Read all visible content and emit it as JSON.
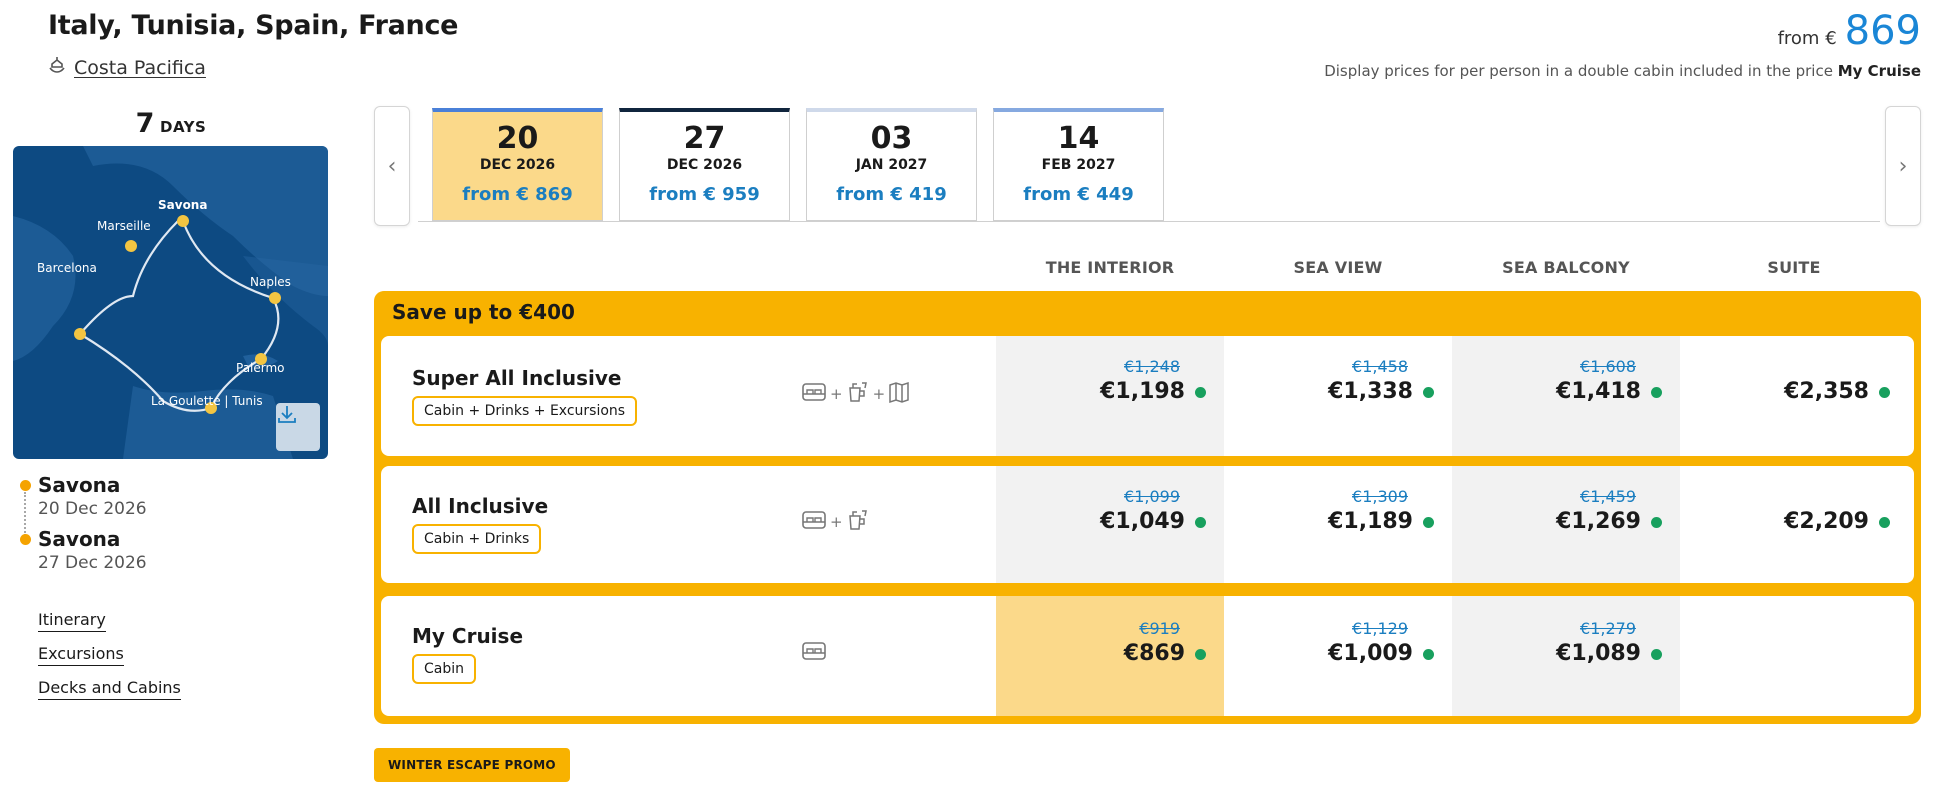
{
  "header": {
    "title": "Italy, Tunisia, Spain, France",
    "ship": "Costa Pacifica",
    "from_label": "from €",
    "from_price": "869",
    "disclaimer": "Display prices for per person in a double cabin included in the price",
    "disclaimer_bold": "My Cruise"
  },
  "duration": {
    "number": "7",
    "label": "DAYS"
  },
  "map": {
    "ports": [
      "Savona",
      "Marseille",
      "Barcelona",
      "Naples",
      "Palermo",
      "La Goulette | Tunis"
    ]
  },
  "stops": [
    {
      "name": "Savona",
      "date": "20 Dec 2026"
    },
    {
      "name": "Savona",
      "date": "27 Dec 2026"
    }
  ],
  "links": [
    "Itinerary",
    "Excursions",
    "Decks and Cabins"
  ],
  "dates": [
    {
      "day": "20",
      "month": "DEC 2026",
      "price": "from € 869"
    },
    {
      "day": "27",
      "month": "DEC 2026",
      "price": "from € 959"
    },
    {
      "day": "03",
      "month": "JAN 2027",
      "price": "from € 419"
    },
    {
      "day": "14",
      "month": "FEB 2027",
      "price": "from € 449"
    }
  ],
  "columns": [
    "THE INTERIOR",
    "SEA VIEW",
    "SEA BALCONY",
    "SUITE"
  ],
  "promo_title": "Save up to €400",
  "rates": [
    {
      "name": "Super All Inclusive",
      "tag": "Cabin + Drinks + Excursions",
      "icons": [
        "bed-icon",
        "drink-icon",
        "map-icon"
      ],
      "plus": "+",
      "prices": [
        {
          "old": "€1,248",
          "new": "€1,198"
        },
        {
          "old": "€1,458",
          "new": "€1,338"
        },
        {
          "old": "€1,608",
          "new": "€1,418"
        },
        {
          "old": "",
          "new": "€2,358"
        }
      ]
    },
    {
      "name": "All Inclusive",
      "tag": "Cabin + Drinks",
      "icons": [
        "bed-icon",
        "drink-icon"
      ],
      "plus": "+",
      "prices": [
        {
          "old": "€1,099",
          "new": "€1,049"
        },
        {
          "old": "€1,309",
          "new": "€1,189"
        },
        {
          "old": "€1,459",
          "new": "€1,269"
        },
        {
          "old": "",
          "new": "€2,209"
        }
      ]
    },
    {
      "name": "My Cruise",
      "tag": "Cabin",
      "icons": [
        "bed-icon"
      ],
      "plus": "+",
      "prices": [
        {
          "old": "€919",
          "new": "€869"
        },
        {
          "old": "€1,129",
          "new": "€1,009"
        },
        {
          "old": "€1,279",
          "new": "€1,089"
        }
      ]
    }
  ],
  "promo_badge": "WINTER ESCAPE PROMO",
  "colors": {
    "accent_orange": "#f8b200",
    "selected_fill": "#fbd98a",
    "price_blue": "#1b7ec0",
    "available_green": "#18a05e",
    "map_sea": "#0d4a82"
  }
}
